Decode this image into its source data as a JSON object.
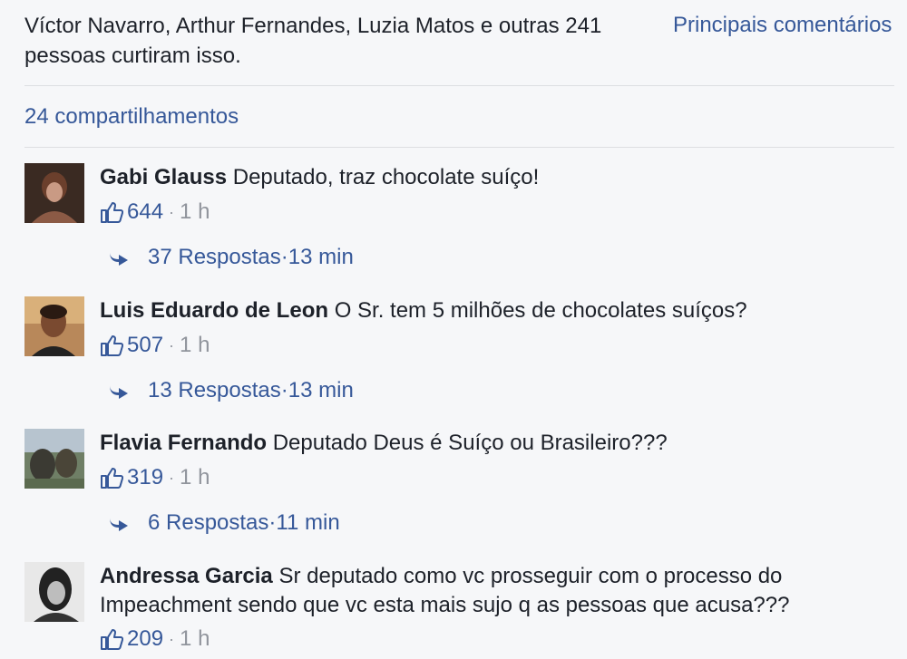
{
  "summary": {
    "likes_text": "Víctor Navarro, Arthur Fernandes, Luzia Matos e outras 241 pessoas curtiram isso.",
    "top_comments_label": "Principais comentários",
    "shares_text": "24 compartilhamentos"
  },
  "comments": [
    {
      "author": "Gabi Glauss",
      "text": "Deputado, traz chocolate suíço!",
      "likes": "644",
      "time": "1 h",
      "replies_label": "37 Respostas",
      "replies_time": "13 min"
    },
    {
      "author": "Luis Eduardo de Leon",
      "text": "O Sr. tem 5 milhões de chocolates suíços?",
      "likes": "507",
      "time": "1 h",
      "replies_label": "13 Respostas",
      "replies_time": "13 min"
    },
    {
      "author": "Flavia Fernando",
      "text": "Deputado Deus é Suíço ou Brasileiro???",
      "likes": "319",
      "time": "1 h",
      "replies_label": "6 Respostas",
      "replies_time": "11 min"
    },
    {
      "author": "Andressa Garcia",
      "text": "Sr deputado como vc prosseguir com o processo do Impeachment sendo que vc esta mais sujo q as pessoas que acusa???",
      "likes": "209",
      "time": "1 h"
    }
  ],
  "meta_separator": "·",
  "colors": {
    "link": "#365899",
    "text": "#1d2129",
    "muted": "#90949c",
    "background": "#f6f7f9"
  },
  "icons": {
    "like": "thumbs-up-icon",
    "reply": "reply-arrow-icon"
  }
}
